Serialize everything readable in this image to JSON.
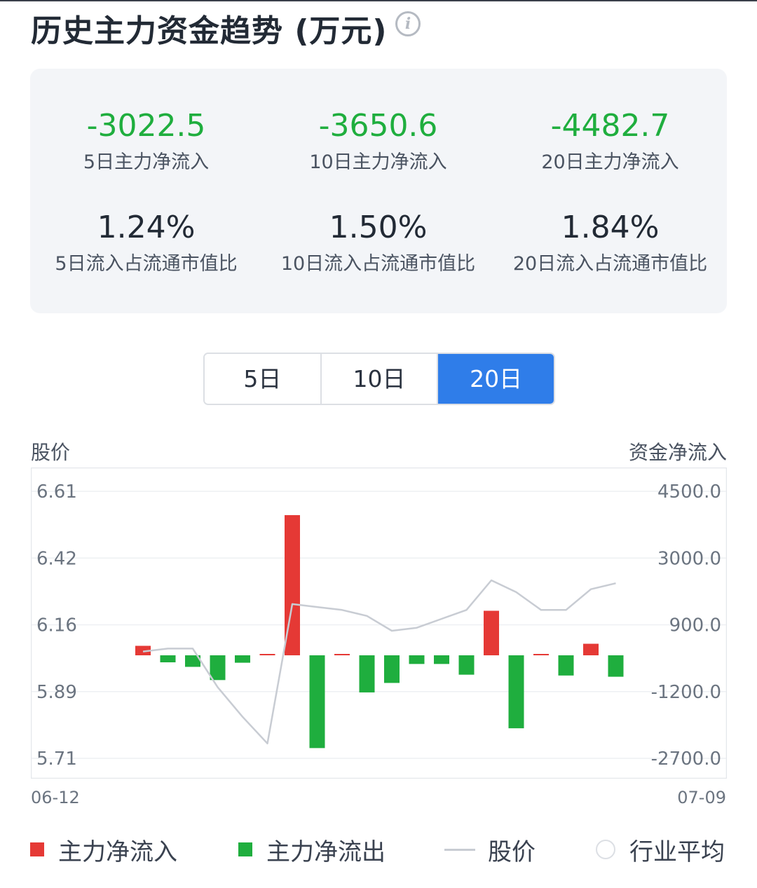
{
  "header": {
    "title": "历史主力资金趋势 (万元)",
    "info_glyph": "i"
  },
  "stats": [
    {
      "value": "-3022.5",
      "label": "5日主力净流入",
      "tone": "green"
    },
    {
      "value": "-3650.6",
      "label": "10日主力净流入",
      "tone": "green"
    },
    {
      "value": "-4482.7",
      "label": "20日主力净流入",
      "tone": "green"
    },
    {
      "value": "1.24%",
      "label": "5日流入占流通市值比",
      "tone": "dark"
    },
    {
      "value": "1.50%",
      "label": "10日流入占流通市值比",
      "tone": "dark"
    },
    {
      "value": "1.84%",
      "label": "20日流入占流通市值比",
      "tone": "dark"
    }
  ],
  "tabs": [
    {
      "label": "5日",
      "active": false
    },
    {
      "label": "10日",
      "active": false
    },
    {
      "label": "20日",
      "active": true
    }
  ],
  "chart": {
    "left_axis_title": "股价",
    "right_axis_title": "资金净流入",
    "start_date": "06-12",
    "end_date": "07-09"
  },
  "legend": {
    "inflow": "主力净流入",
    "outflow": "主力净流出",
    "price": "股价",
    "industry": "行业平均"
  },
  "colors": {
    "inflow": "#e53935",
    "outflow": "#1fae3e",
    "price": "#c8ccd3",
    "accent": "#2f7de9"
  },
  "chart_data": {
    "type": "bar",
    "x": [
      "06-12",
      "07-09"
    ],
    "series": [
      {
        "name": "主力净流入/主力净流出",
        "values": [
          230,
          -170,
          -280,
          -600,
          -180,
          20,
          3400,
          -2250,
          20,
          -900,
          -670,
          -210,
          -210,
          -470,
          1080,
          -1770,
          0,
          -490,
          280,
          -520
        ]
      },
      {
        "name": "股价",
        "type": "line",
        "values": [
          6.07,
          6.08,
          6.08,
          5.95,
          5.85,
          5.76,
          6.23,
          6.22,
          6.21,
          6.19,
          6.14,
          6.15,
          6.18,
          6.21,
          6.31,
          6.27,
          6.21,
          6.21,
          6.28,
          6.3
        ]
      }
    ],
    "y_left": {
      "ticks": [
        "6.61",
        "6.42",
        "6.16",
        "5.89",
        "5.71"
      ],
      "min": 5.71,
      "max": 6.61
    },
    "y_right": {
      "ticks": [
        "4500.0",
        "3000.0",
        "900.0",
        "-1200.0",
        "-2700.0"
      ]
    },
    "grid": true
  }
}
